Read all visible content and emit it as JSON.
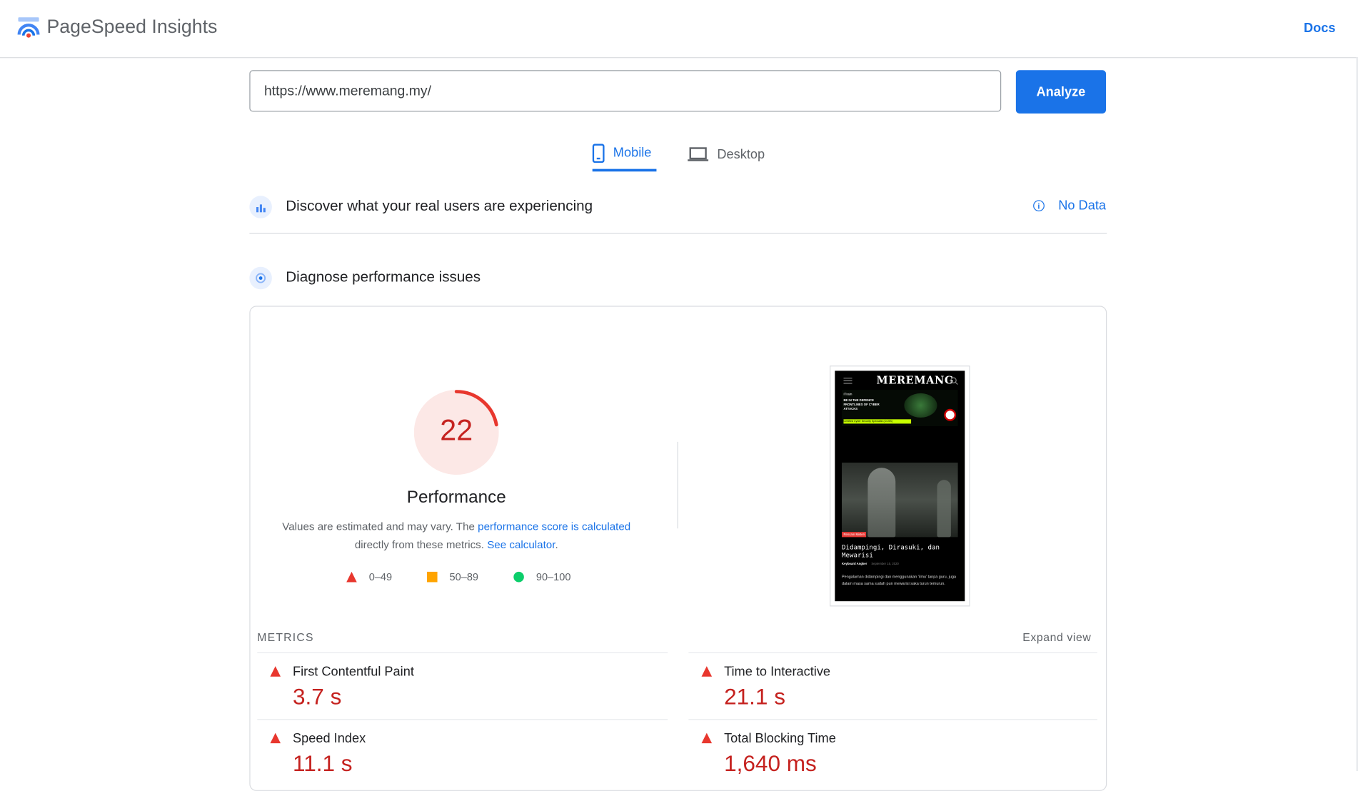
{
  "header": {
    "brand": "PageSpeed Insights",
    "docs_label": "Docs"
  },
  "search": {
    "url": "https://www.meremang.my/",
    "analyze_label": "Analyze"
  },
  "tabs": [
    {
      "label": "Mobile",
      "active": true
    },
    {
      "label": "Desktop",
      "active": false
    }
  ],
  "field_data": {
    "title": "Discover what your real users are experiencing",
    "status": "No Data"
  },
  "lab_data": {
    "title": "Diagnose performance issues"
  },
  "performance": {
    "score": "22",
    "score_fraction": 0.22,
    "label": "Performance",
    "note_prefix": "Values are estimated and may vary. The ",
    "note_link1": "performance score is calculated",
    "note_middle": " directly from these metrics. ",
    "note_link2": "See calculator",
    "note_suffix": ".",
    "legend": [
      {
        "range": "0–49",
        "color": "#e8372e",
        "shape": "triangle"
      },
      {
        "range": "50–89",
        "color": "#ffa400",
        "shape": "square"
      },
      {
        "range": "90–100",
        "color": "#0cce6b",
        "shape": "circle"
      }
    ]
  },
  "screenshot": {
    "site_logo": "MEREMANG",
    "ad_brand": "iTrain",
    "ad_text": "BE IN THE DEFENCE FRONTLINES OF CYBER ATTACKS",
    "ad_badge": "Certified Cyber Security Specialist (CCSS)",
    "category": "Rencam Misteri",
    "headline": "Didampingi, Dirasuki, dan Mewarisi",
    "author": "Keyboard Angker",
    "date": "September 15, 2020",
    "excerpt": "Pengalaman didampingi dan menggunakan ‘ilmu’ tanpa guru, juga dalam masa sama sudah pun mewarisi saka turun temurun."
  },
  "metrics": {
    "section_label": "METRICS",
    "expand_label": "Expand view",
    "items": [
      {
        "name": "First Contentful Paint",
        "value": "3.7 s"
      },
      {
        "name": "Time to Interactive",
        "value": "21.1 s"
      },
      {
        "name": "Speed Index",
        "value": "11.1 s"
      },
      {
        "name": "Total Blocking Time",
        "value": "1,640 ms"
      }
    ]
  },
  "colors": {
    "accent": "#1a73e8",
    "fail": "#c5221f",
    "fail_icon": "#e8372e"
  }
}
